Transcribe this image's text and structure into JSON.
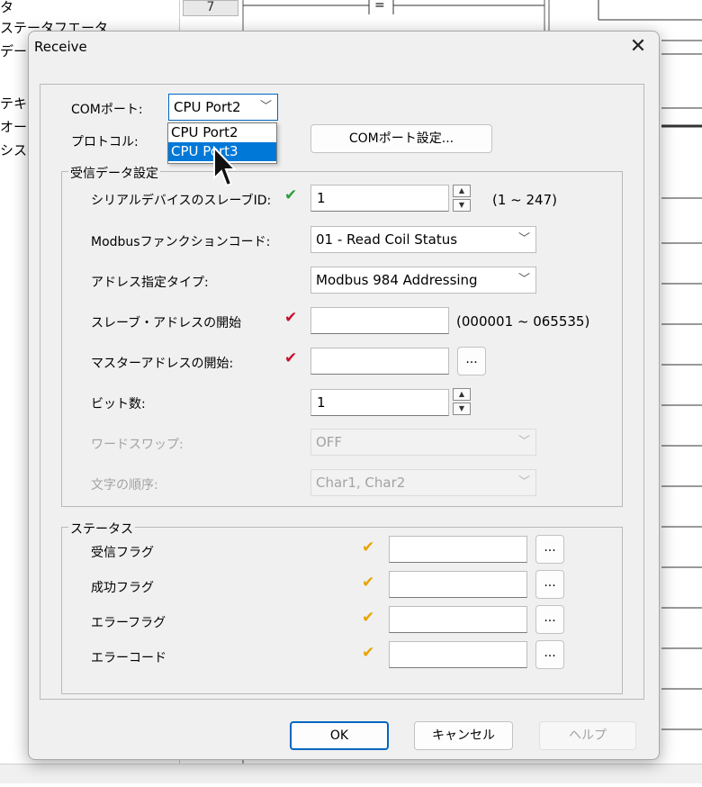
{
  "background": {
    "left_items": [
      "タ",
      "ステータフエータ",
      "デー",
      "テキ",
      "オー",
      "シス"
    ],
    "row_number": "7",
    "equals": "="
  },
  "dialog": {
    "title": "Receive",
    "close_glyph": "✕"
  },
  "com": {
    "label": "COMポート:",
    "selected": "CPU Port2",
    "options": [
      "CPU Port2",
      "CPU Port3"
    ],
    "highlighted_option": "CPU Port3",
    "settings_button": "COMポート設定..."
  },
  "protocol": {
    "label": "プロトコル:"
  },
  "receive_settings": {
    "group_title": "受信データ設定",
    "slave_id": {
      "label": "シリアルデバイスのスレーブID:",
      "value": "1",
      "range": "(1 ~ 247)"
    },
    "function_code": {
      "label": "Modbusファンクションコード:",
      "value": "01 - Read Coil Status"
    },
    "address_type": {
      "label": "アドレス指定タイプ:",
      "value": "Modbus 984 Addressing"
    },
    "slave_address_start": {
      "label": "スレーブ・アドレスの開始",
      "value": "",
      "range": "(000001 ~ 065535)"
    },
    "master_address_start": {
      "label": "マスターアドレスの開始:",
      "value": "",
      "button": "..."
    },
    "bit_count": {
      "label": "ビット数:",
      "value": "1"
    },
    "word_swap": {
      "label": "ワードスワップ:",
      "value": "OFF"
    },
    "char_order": {
      "label": "文字の順序:",
      "value": "Char1, Char2"
    }
  },
  "status": {
    "group_title": "ステータス",
    "rows": [
      {
        "label": "受信フラグ",
        "value": "",
        "button": "..."
      },
      {
        "label": "成功フラグ",
        "value": "",
        "button": "..."
      },
      {
        "label": "エラーフラグ",
        "value": "",
        "button": "..."
      },
      {
        "label": "エラーコード",
        "value": "",
        "button": "..."
      }
    ]
  },
  "buttons": {
    "ok": "OK",
    "cancel": "キャンセル",
    "help": "ヘルプ"
  },
  "colors": {
    "check_green": "#2e9e3a",
    "check_red": "#c8102e",
    "check_yellow": "#e8a300",
    "accent_blue": "#0067c0",
    "selection_blue": "#0078d7"
  }
}
